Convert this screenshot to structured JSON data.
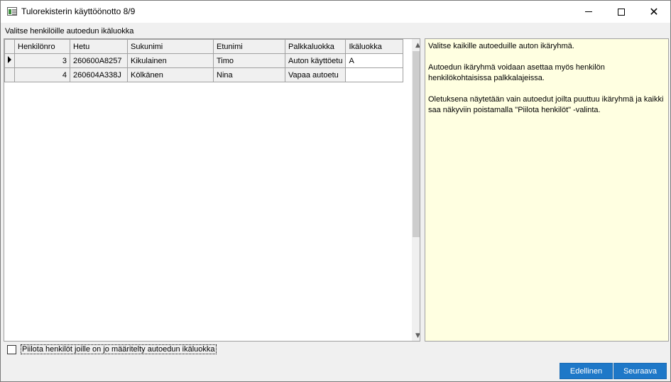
{
  "window": {
    "title": "Tulorekisterin käyttöönotto 8/9"
  },
  "section_label": "Valitse henkilöille autoedun ikäluokka",
  "grid": {
    "columns": [
      "Henkilönro",
      "Hetu",
      "Sukunimi",
      "Etunimi",
      "Palkkaluokka",
      "Ikäluokka"
    ],
    "rows": [
      {
        "henkilonro": "3",
        "hetu": "260600A8257",
        "sukunimi": "Kikulainen",
        "etunimi": "Timo",
        "palkkaluokka": "Auton käyttöetu",
        "ikaluokka": "A",
        "current": true
      },
      {
        "henkilonro": "4",
        "hetu": "260604A338J",
        "sukunimi": "Kölkänen",
        "etunimi": "Nina",
        "palkkaluokka": "Vapaa autoetu",
        "ikaluokka": "",
        "current": false
      }
    ]
  },
  "help": {
    "p1": "Valitse kaikille autoeduille auton ikäryhmä.",
    "p2": "Autoedun ikäryhmä voidaan asettaa myös henkilön henkilökohtaisissa palkkalajeissa.",
    "p3": "Oletuksena näytetään vain autoedut joilta puuttuu ikäryhmä ja kaikki saa näkyviin poistamalla \"Piilota henkilöt\" -valinta."
  },
  "filter": {
    "label": "Piilota henkilöt joille on jo määritelty autoedun ikäluokka",
    "checked": false
  },
  "buttons": {
    "previous": "Edellinen",
    "next": "Seuraava"
  },
  "colors": {
    "accent": "#1e78c8",
    "help_background": "#ffffe1"
  },
  "icons": {
    "app": "app-icon",
    "minimize": "minimize-icon",
    "maximize": "maximize-icon",
    "close": "close-icon"
  }
}
